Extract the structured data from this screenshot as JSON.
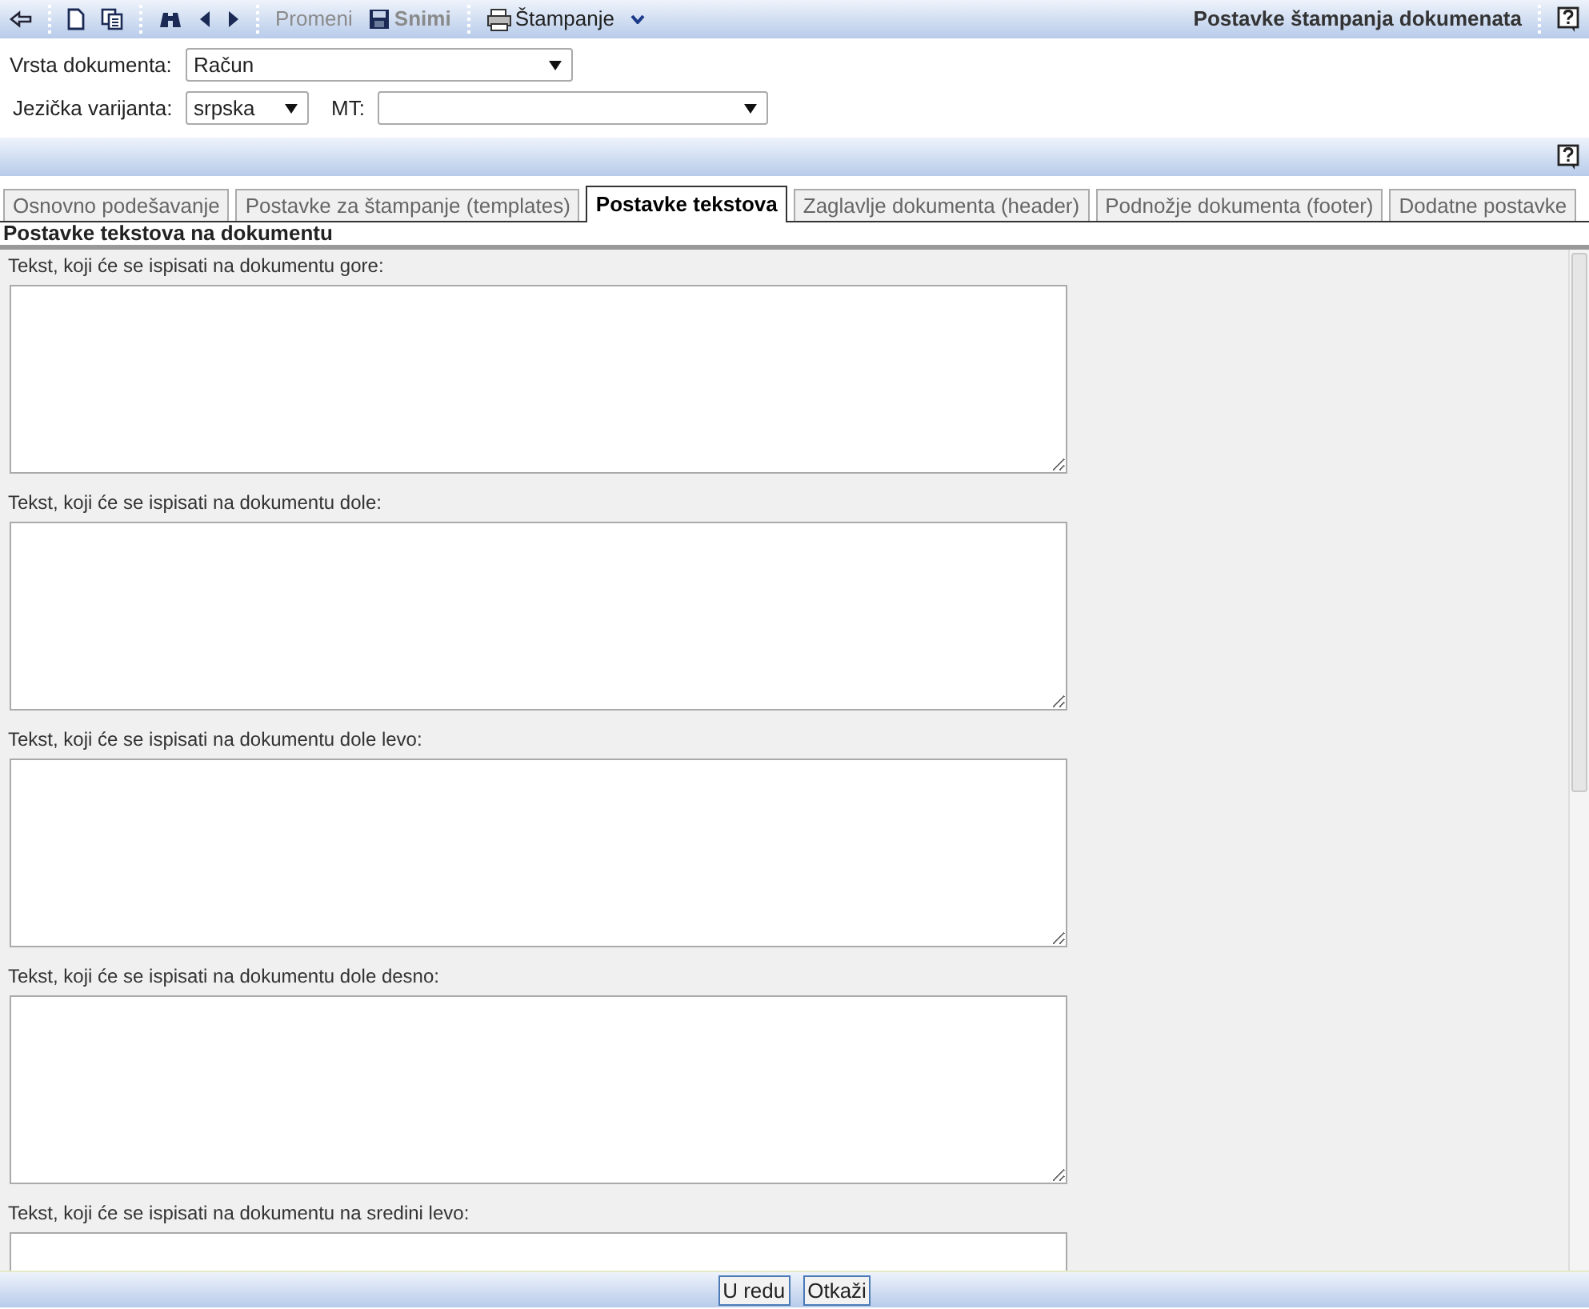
{
  "toolbar": {
    "actions": [
      {
        "label": "Promeni",
        "disabled": true
      },
      {
        "label": "Snimi",
        "disabled": true
      },
      {
        "label": "Štampanje",
        "disabled": false
      }
    ],
    "title": "Postavke štampanja dokumenata"
  },
  "form": {
    "fields": [
      {
        "label": "Vrsta dokumenta:",
        "value": "Račun"
      },
      {
        "label": "Jezička varijanta:",
        "value": "srpska"
      },
      {
        "label": "MT:"
      }
    ]
  },
  "tabs": [
    {
      "label": "Osnovno podešavanje",
      "selected": false
    },
    {
      "label": "Postavke za štampanje (templates)",
      "selected": false
    },
    {
      "label": "Postavke tekstova",
      "selected": true
    },
    {
      "label": "Zaglavlje dokumenta (header)",
      "selected": false
    },
    {
      "label": "Podnožje dokumenta (footer)",
      "selected": false
    },
    {
      "label": "Dodatne postavke",
      "selected": false
    }
  ],
  "section": {
    "title": "Postavke tekstova na dokumentu",
    "texts": [
      {
        "label": "Tekst, koji će se ispisati na dokumentu gore:"
      },
      {
        "label": "Tekst, koji će se ispisati na dokumentu dole:"
      },
      {
        "label": "Tekst, koji će se ispisati na dokumentu dole levo:"
      },
      {
        "label": "Tekst, koji će se ispisati na dokumentu dole desno:"
      },
      {
        "label": "Tekst, koji će se ispisati na dokumentu na sredini levo:"
      }
    ]
  },
  "footer": {
    "buttons": [
      "U redu",
      "Otkaži"
    ]
  }
}
